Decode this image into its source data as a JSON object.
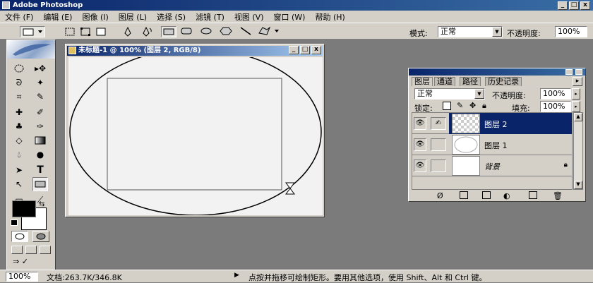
{
  "app": {
    "title": "Adobe Photoshop"
  },
  "menu": [
    "文件 (F)",
    "编辑 (E)",
    "图像 (I)",
    "图层 (L)",
    "选择 (S)",
    "滤镜 (T)",
    "视图 (V)",
    "窗口 (W)",
    "帮助 (H)"
  ],
  "options": {
    "mode_label": "模式:",
    "mode_value": "正常",
    "opacity_label": "不透明度:",
    "opacity_value": "100%"
  },
  "document": {
    "title": "未标题-1 @ 100% (图层 2, RGB/8)"
  },
  "layers_palette": {
    "tabs": [
      "图层",
      "通道",
      "路径",
      "历史记录"
    ],
    "blend_mode": "正常",
    "opacity_label": "不透明度:",
    "opacity_value": "100%",
    "lock_label": "锁定:",
    "fill_label": "填充:",
    "fill_value": "100%",
    "layers": [
      {
        "name": "图层 2",
        "selected": true
      },
      {
        "name": "图层 1",
        "selected": false
      },
      {
        "name": "背景",
        "selected": false,
        "locked": true
      }
    ]
  },
  "status": {
    "zoom": "100%",
    "doc_info": "文档:263.7K/346.8K",
    "hint": "点按并拖移可绘制矩形。要用其他选项，使用 Shift、Alt 和 Ctrl 键。"
  },
  "colors": {
    "titlebar": "#0a246a",
    "selected_layer": "#0a246a",
    "workspace": "#7b7b7b"
  }
}
